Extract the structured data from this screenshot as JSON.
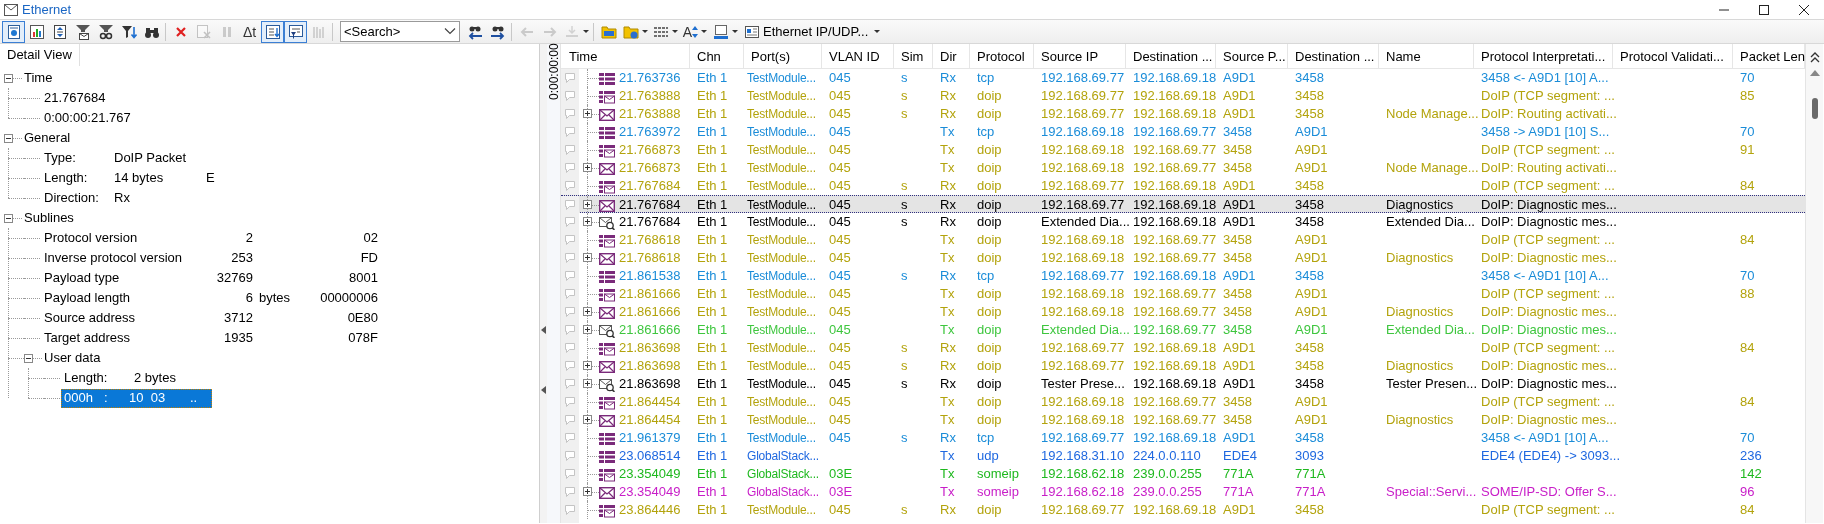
{
  "window": {
    "title": "Ethernet"
  },
  "toolbar": [
    {
      "kind": "button",
      "on": true,
      "disabled": false
    },
    {
      "kind": "button",
      "on": false,
      "disabled": false
    },
    {
      "kind": "button",
      "on": false,
      "disabled": false
    },
    {
      "kind": "button",
      "on": false,
      "disabled": false
    },
    {
      "kind": "button",
      "on": false,
      "disabled": false
    },
    {
      "kind": "button",
      "on": false,
      "disabled": false
    },
    {
      "kind": "button",
      "on": false,
      "disabled": false
    },
    {
      "kind": "separator"
    },
    {
      "kind": "button",
      "on": false,
      "disabled": false
    },
    {
      "kind": "button",
      "on": false,
      "disabled": true
    },
    {
      "kind": "button",
      "on": false,
      "disabled": true
    },
    {
      "kind": "text-button",
      "label": "Δt"
    },
    {
      "kind": "button",
      "on": true,
      "disabled": false
    },
    {
      "kind": "button",
      "on": true,
      "disabled": false
    },
    {
      "kind": "button",
      "on": false,
      "disabled": true
    },
    {
      "kind": "separator"
    },
    {
      "kind": "search",
      "placeholder": "<Search>"
    },
    {
      "kind": "button",
      "on": false,
      "disabled": false
    },
    {
      "kind": "button",
      "on": false,
      "disabled": false
    },
    {
      "kind": "separator"
    },
    {
      "kind": "button",
      "on": false,
      "disabled": true
    },
    {
      "kind": "button",
      "on": false,
      "disabled": true
    },
    {
      "kind": "button",
      "on": false,
      "disabled": true,
      "dropdown": true
    },
    {
      "kind": "separator"
    },
    {
      "kind": "button",
      "on": false,
      "disabled": false
    },
    {
      "kind": "button",
      "on": false,
      "disabled": false,
      "dropdown": true
    },
    {
      "kind": "button",
      "on": false,
      "disabled": false,
      "dropdown": true
    },
    {
      "kind": "font-button",
      "label": "A"
    },
    {
      "kind": "button",
      "on": false,
      "disabled": false,
      "dropdown": true
    },
    {
      "kind": "menu",
      "label": "Ethernet IP/UDP..."
    }
  ],
  "detail_view": {
    "title": "Detail View",
    "tree": [
      {
        "label": "Time",
        "kind": "plain",
        "expanded": true,
        "children": [
          {
            "label": "21.767684"
          },
          {
            "label": "0:00:00:21.767"
          }
        ]
      },
      {
        "label": "General",
        "kind": "fields",
        "expanded": true,
        "children": [
          {
            "label": "Type:",
            "value": "DoIP Packet"
          },
          {
            "label": "Length:",
            "value": "14 bytes",
            "raw": "E"
          },
          {
            "label": "Direction:",
            "value": "Rx"
          }
        ]
      },
      {
        "label": "Sublines",
        "kind": "table",
        "expanded": true,
        "children": [
          {
            "label": "Protocol version",
            "value": "2",
            "raw": "02"
          },
          {
            "label": "Inverse protocol version",
            "value": "253",
            "raw": "FD"
          },
          {
            "label": "Payload type",
            "value": "32769",
            "raw": "8001"
          },
          {
            "label": "Payload length",
            "value": "6",
            "unit": "bytes",
            "raw": "00000006"
          },
          {
            "label": "Source address",
            "value": "3712",
            "raw": "0E80"
          },
          {
            "label": "Target address",
            "value": "1935",
            "raw": "078F"
          },
          {
            "label": "User data",
            "kind": "fields",
            "expanded": true,
            "children": [
              {
                "label": "Length:",
                "value": "2 bytes",
                "selected": false
              },
              {
                "kind": "hex",
                "offset": "000h",
                "separator": ":",
                "bytes": "10  03",
                "ascii": "..",
                "selected": true
              }
            ]
          }
        ]
      }
    ]
  },
  "trace": {
    "time_ruler": "0:00:00:00",
    "columns": [
      "Time",
      "Chn",
      "Port(s)",
      "VLAN ID",
      "Sim",
      "Dir",
      "Protocol",
      "Source IP",
      "Destination ...",
      "Source P...",
      "Destination ...",
      "Name",
      "Protocol Interpretati...",
      "Protocol Validati...",
      "Packet Len"
    ],
    "rows": [
      {
        "time": "21.763736",
        "chn": "Eth 1",
        "port": "TestModule...",
        "vlan": "045",
        "sim": "s",
        "dir": "Rx",
        "protocol": "tcp",
        "source_ip": "192.168.69.77",
        "destination_ip": "192.168.69.18",
        "source_port": "A9D1",
        "destination_port": "3458",
        "interpretation": "3458 <- A9D1 [10] A...",
        "packet_length": "70",
        "kind": "frame",
        "color": "#1a8cd8",
        "selected": false
      },
      {
        "time": "21.763888",
        "chn": "Eth 1",
        "port": "TestModule...",
        "vlan": "045",
        "sim": "s",
        "dir": "Rx",
        "protocol": "doip",
        "source_ip": "192.168.69.77",
        "destination_ip": "192.168.69.18",
        "source_port": "A9D1",
        "destination_port": "3458",
        "interpretation": "DoIP (TCP segment: ...",
        "packet_length": "85",
        "kind": "segment",
        "color": "#b3a30c",
        "selected": false
      },
      {
        "time": "21.763888",
        "chn": "Eth 1",
        "port": "TestModule...",
        "vlan": "045",
        "sim": "s",
        "dir": "Rx",
        "protocol": "doip",
        "source_ip": "192.168.69.77",
        "destination_ip": "192.168.69.18",
        "source_port": "A9D1",
        "destination_port": "3458",
        "name": "Node Manage...",
        "interpretation": "DoIP: Routing activati...",
        "kind": "message",
        "color": "#b3a30c",
        "selected": false
      },
      {
        "time": "21.763972",
        "chn": "Eth 1",
        "port": "TestModule...",
        "vlan": "045",
        "dir": "Tx",
        "protocol": "tcp",
        "source_ip": "192.168.69.18",
        "destination_ip": "192.168.69.77",
        "source_port": "3458",
        "destination_port": "A9D1",
        "interpretation": "3458 -> A9D1 [10] S...",
        "packet_length": "70",
        "kind": "frame",
        "color": "#1a8cd8",
        "selected": false
      },
      {
        "time": "21.766873",
        "chn": "Eth 1",
        "port": "TestModule...",
        "vlan": "045",
        "dir": "Tx",
        "protocol": "doip",
        "source_ip": "192.168.69.18",
        "destination_ip": "192.168.69.77",
        "source_port": "3458",
        "destination_port": "A9D1",
        "interpretation": "DoIP (TCP segment: ...",
        "packet_length": "91",
        "kind": "segment",
        "color": "#b3a30c",
        "selected": false
      },
      {
        "time": "21.766873",
        "chn": "Eth 1",
        "port": "TestModule...",
        "vlan": "045",
        "dir": "Tx",
        "protocol": "doip",
        "source_ip": "192.168.69.18",
        "destination_ip": "192.168.69.77",
        "source_port": "3458",
        "destination_port": "A9D1",
        "name": "Node Manage...",
        "interpretation": "DoIP: Routing activati...",
        "kind": "message",
        "color": "#b3a30c",
        "selected": false
      },
      {
        "time": "21.767684",
        "chn": "Eth 1",
        "port": "TestModule...",
        "vlan": "045",
        "sim": "s",
        "dir": "Rx",
        "protocol": "doip",
        "source_ip": "192.168.69.77",
        "destination_ip": "192.168.69.18",
        "source_port": "A9D1",
        "destination_port": "3458",
        "interpretation": "DoIP (TCP segment: ...",
        "packet_length": "84",
        "kind": "segment",
        "color": "#b3a30c",
        "selected": false
      },
      {
        "time": "21.767684",
        "chn": "Eth 1",
        "port": "TestModule...",
        "vlan": "045",
        "sim": "s",
        "dir": "Rx",
        "protocol": "doip",
        "source_ip": "192.168.69.77",
        "destination_ip": "192.168.69.18",
        "source_port": "A9D1",
        "destination_port": "3458",
        "name": "Diagnostics",
        "interpretation": "DoIP: Diagnostic mes...",
        "kind": "message",
        "color": "#000000",
        "selected": true
      },
      {
        "time": "21.767684",
        "chn": "Eth 1",
        "port": "TestModule...",
        "vlan": "045",
        "sim": "s",
        "dir": "Rx",
        "protocol": "doip",
        "source_ip": "Extended Dia...",
        "destination_ip": "192.168.69.18",
        "source_port": "A9D1",
        "destination_port": "3458",
        "name": "Extended Dia...",
        "interpretation": "DoIP: Diagnostic mes...",
        "kind": "diagnostic",
        "color": "#000000",
        "selected": false
      },
      {
        "time": "21.768618",
        "chn": "Eth 1",
        "port": "TestModule...",
        "vlan": "045",
        "dir": "Tx",
        "protocol": "doip",
        "source_ip": "192.168.69.18",
        "destination_ip": "192.168.69.77",
        "source_port": "3458",
        "destination_port": "A9D1",
        "interpretation": "DoIP (TCP segment: ...",
        "packet_length": "84",
        "kind": "segment",
        "color": "#b3a30c",
        "selected": false
      },
      {
        "time": "21.768618",
        "chn": "Eth 1",
        "port": "TestModule...",
        "vlan": "045",
        "dir": "Tx",
        "protocol": "doip",
        "source_ip": "192.168.69.18",
        "destination_ip": "192.168.69.77",
        "source_port": "3458",
        "destination_port": "A9D1",
        "name": "Diagnostics",
        "interpretation": "DoIP: Diagnostic mes...",
        "kind": "message",
        "color": "#b3a30c",
        "selected": false
      },
      {
        "time": "21.861538",
        "chn": "Eth 1",
        "port": "TestModule...",
        "vlan": "045",
        "sim": "s",
        "dir": "Rx",
        "protocol": "tcp",
        "source_ip": "192.168.69.77",
        "destination_ip": "192.168.69.18",
        "source_port": "A9D1",
        "destination_port": "3458",
        "interpretation": "3458 <- A9D1 [10] A...",
        "packet_length": "70",
        "kind": "frame",
        "color": "#1a8cd8",
        "selected": false
      },
      {
        "time": "21.861666",
        "chn": "Eth 1",
        "port": "TestModule...",
        "vlan": "045",
        "dir": "Tx",
        "protocol": "doip",
        "source_ip": "192.168.69.18",
        "destination_ip": "192.168.69.77",
        "source_port": "3458",
        "destination_port": "A9D1",
        "interpretation": "DoIP (TCP segment: ...",
        "packet_length": "88",
        "kind": "segment",
        "color": "#b3a30c",
        "selected": false
      },
      {
        "time": "21.861666",
        "chn": "Eth 1",
        "port": "TestModule...",
        "vlan": "045",
        "dir": "Tx",
        "protocol": "doip",
        "source_ip": "192.168.69.18",
        "destination_ip": "192.168.69.77",
        "source_port": "3458",
        "destination_port": "A9D1",
        "name": "Diagnostics",
        "interpretation": "DoIP: Diagnostic mes...",
        "kind": "message",
        "color": "#b3a30c",
        "selected": false
      },
      {
        "time": "21.861666",
        "chn": "Eth 1",
        "port": "TestModule...",
        "vlan": "045",
        "dir": "Tx",
        "protocol": "doip",
        "source_ip": "Extended Dia...",
        "destination_ip": "192.168.69.77",
        "source_port": "3458",
        "destination_port": "A9D1",
        "name": "Extended Dia...",
        "interpretation": "DoIP: Diagnostic mes...",
        "kind": "diagnostic",
        "color": "#3ec63e",
        "selected": false
      },
      {
        "time": "21.863698",
        "chn": "Eth 1",
        "port": "TestModule...",
        "vlan": "045",
        "sim": "s",
        "dir": "Rx",
        "protocol": "doip",
        "source_ip": "192.168.69.77",
        "destination_ip": "192.168.69.18",
        "source_port": "A9D1",
        "destination_port": "3458",
        "interpretation": "DoIP (TCP segment: ...",
        "packet_length": "84",
        "kind": "segment",
        "color": "#b3a30c",
        "selected": false
      },
      {
        "time": "21.863698",
        "chn": "Eth 1",
        "port": "TestModule...",
        "vlan": "045",
        "sim": "s",
        "dir": "Rx",
        "protocol": "doip",
        "source_ip": "192.168.69.77",
        "destination_ip": "192.168.69.18",
        "source_port": "A9D1",
        "destination_port": "3458",
        "name": "Diagnostics",
        "interpretation": "DoIP: Diagnostic mes...",
        "kind": "message",
        "color": "#b3a30c",
        "selected": false
      },
      {
        "time": "21.863698",
        "chn": "Eth 1",
        "port": "TestModule...",
        "vlan": "045",
        "sim": "s",
        "dir": "Rx",
        "protocol": "doip",
        "source_ip": "Tester Prese...",
        "destination_ip": "192.168.69.18",
        "source_port": "A9D1",
        "destination_port": "3458",
        "name": "Tester Presen...",
        "interpretation": "DoIP: Diagnostic mes...",
        "kind": "diagnostic",
        "color": "#000000",
        "selected": false
      },
      {
        "time": "21.864454",
        "chn": "Eth 1",
        "port": "TestModule...",
        "vlan": "045",
        "dir": "Tx",
        "protocol": "doip",
        "source_ip": "192.168.69.18",
        "destination_ip": "192.168.69.77",
        "source_port": "3458",
        "destination_port": "A9D1",
        "interpretation": "DoIP (TCP segment: ...",
        "packet_length": "84",
        "kind": "segment",
        "color": "#b3a30c",
        "selected": false
      },
      {
        "time": "21.864454",
        "chn": "Eth 1",
        "port": "TestModule...",
        "vlan": "045",
        "dir": "Tx",
        "protocol": "doip",
        "source_ip": "192.168.69.18",
        "destination_ip": "192.168.69.77",
        "source_port": "3458",
        "destination_port": "A9D1",
        "name": "Diagnostics",
        "interpretation": "DoIP: Diagnostic mes...",
        "kind": "message",
        "color": "#b3a30c",
        "selected": false
      },
      {
        "time": "21.961379",
        "chn": "Eth 1",
        "port": "TestModule...",
        "vlan": "045",
        "sim": "s",
        "dir": "Rx",
        "protocol": "tcp",
        "source_ip": "192.168.69.77",
        "destination_ip": "192.168.69.18",
        "source_port": "A9D1",
        "destination_port": "3458",
        "interpretation": "3458 <- A9D1 [10] A...",
        "packet_length": "70",
        "kind": "frame",
        "color": "#1a8cd8",
        "selected": false
      },
      {
        "time": "23.068514",
        "chn": "Eth 1",
        "port": "GlobalStack...",
        "dir": "Tx",
        "protocol": "udp",
        "source_ip": "192.168.31.10",
        "destination_ip": "224.0.0.110",
        "source_port": "EDE4",
        "destination_port": "3093",
        "interpretation": "EDE4 (EDE4) -> 3093...",
        "packet_length": "236",
        "kind": "frame",
        "color": "#1f68e0",
        "selected": false
      },
      {
        "time": "23.354049",
        "chn": "Eth 1",
        "port": "GlobalStack...",
        "vlan": "03E",
        "dir": "Tx",
        "protocol": "someip",
        "source_ip": "192.168.62.18",
        "destination_ip": "239.0.0.255",
        "source_port": "771A",
        "destination_port": "771A",
        "packet_length": "142",
        "kind": "segment",
        "color": "#1eb81e",
        "selected": false
      },
      {
        "time": "23.354049",
        "chn": "Eth 1",
        "port": "GlobalStack...",
        "vlan": "03E",
        "dir": "Tx",
        "protocol": "someip",
        "source_ip": "192.168.62.18",
        "destination_ip": "239.0.0.255",
        "source_port": "771A",
        "destination_port": "771A",
        "name": "Special::Servi...",
        "interpretation": "SOME/IP-SD: Offer S...",
        "packet_length": "96",
        "kind": "message",
        "color": "#c81ec8",
        "selected": false
      },
      {
        "time": "23.864446",
        "chn": "Eth 1",
        "port": "TestModule...",
        "vlan": "045",
        "sim": "s",
        "dir": "Rx",
        "protocol": "doip",
        "source_ip": "192.168.69.77",
        "destination_ip": "192.168.69.18",
        "source_port": "A9D1",
        "destination_port": "3458",
        "interpretation": "DoIP (TCP segment: ...",
        "packet_length": "84",
        "kind": "segment",
        "color": "#b3a30c",
        "selected": false
      }
    ]
  }
}
